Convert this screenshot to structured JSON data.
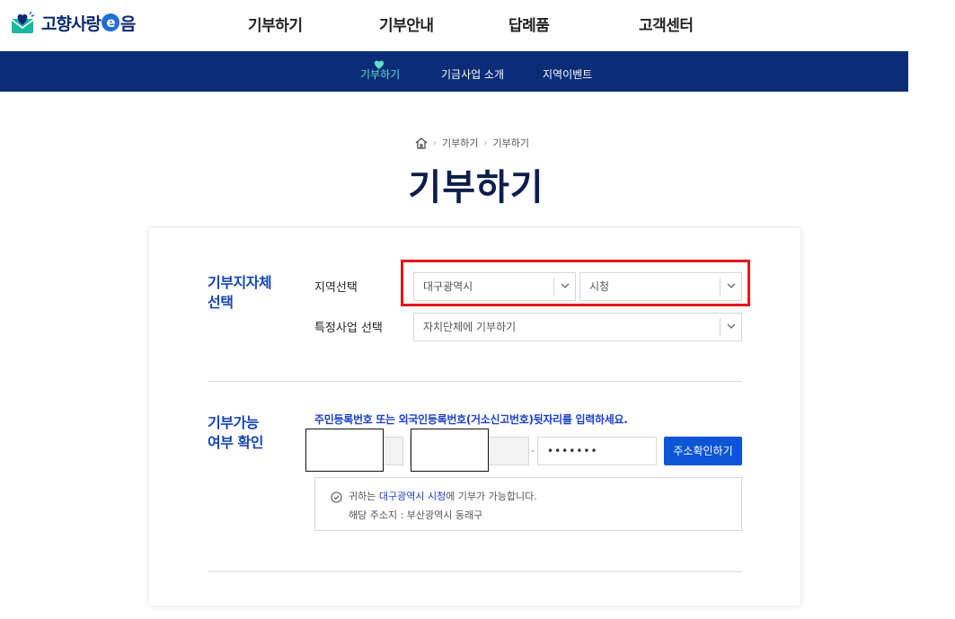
{
  "header": {
    "logo_text_1": "고향사랑",
    "logo_e": "e",
    "logo_text_2": "음",
    "nav": [
      {
        "label": "기부하기"
      },
      {
        "label": "기부안내"
      },
      {
        "label": "답례품"
      },
      {
        "label": "고객센터"
      }
    ]
  },
  "subnav": {
    "items": [
      {
        "label": "기부하기"
      },
      {
        "label": "기금사업 소개"
      },
      {
        "label": "지역이벤트"
      }
    ],
    "active_color": "#5fe0c8"
  },
  "breadcrumb": {
    "items": [
      "기부하기",
      "기부하기"
    ],
    "separator": "›"
  },
  "page_title": "기부하기",
  "section_local": {
    "title_1": "기부지자체",
    "title_2": "선택",
    "region_label": "지역선택",
    "region_select_value": "대구광역시",
    "city_select_value": "시청",
    "project_label": "특정사업 선택",
    "project_select_value": "자치단체에 기부하기"
  },
  "section_eligibility": {
    "title_1": "기부가능",
    "title_2": "여부 확인",
    "notice": "주민등록번호 또는 외국인등록번호(거소신고번호)뒷자리를 입력하세요.",
    "dash": "-",
    "password_value": "•••••••",
    "address_button": "주소확인하기",
    "result_prefix": "귀하는 ",
    "result_highlight": "대구광역시 시청",
    "result_suffix": "에 기부가 가능합니다.",
    "result_address": "해당 주소지 : 부산광역시 동래구"
  },
  "colors": {
    "brand_navy": "#0b2d78",
    "accent_blue": "#0b55d6",
    "section_title": "#1546b3",
    "highlight_red": "#e8141b"
  }
}
